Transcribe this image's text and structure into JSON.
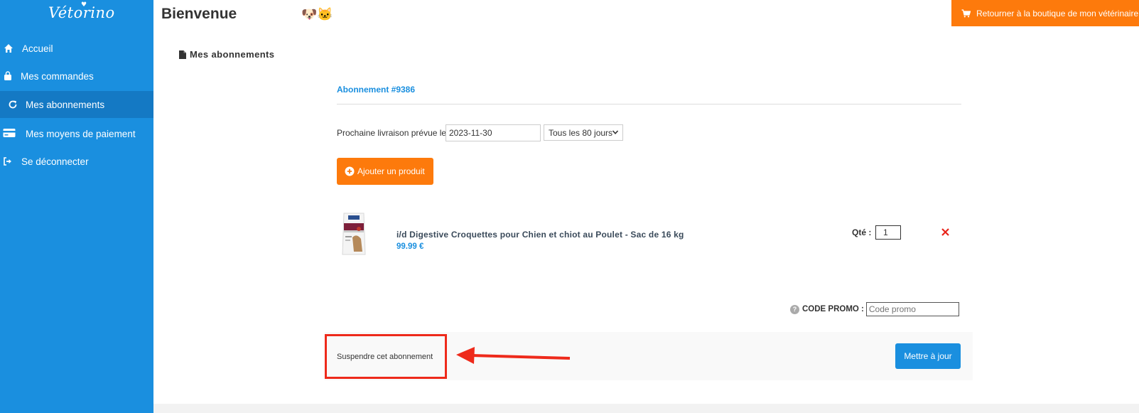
{
  "sidebar": {
    "logo": "Vétorino",
    "items": [
      {
        "label": "Accueil",
        "icon": "home-icon"
      },
      {
        "label": "Mes commandes",
        "icon": "bag-icon"
      },
      {
        "label": "Mes abonnements",
        "icon": "refresh-icon",
        "active": true
      },
      {
        "label": "Mes moyens de paiement",
        "icon": "credit-card-icon"
      },
      {
        "label": "Se déconnecter",
        "icon": "logout-icon"
      }
    ]
  },
  "header": {
    "title": "Bienvenue",
    "pets": "🐶🐱",
    "shop_button": "Retourner à la boutique de mon vétérinaire"
  },
  "section": {
    "title": "Mes abonnements"
  },
  "subscription": {
    "title": "Abonnement #9386",
    "next_delivery_label": "Prochaine livraison prévue le",
    "next_delivery_date": "2023-11-30",
    "frequency": "Tous les 80 jours",
    "add_product_label": "Ajouter un produit",
    "product": {
      "name": "i/d Digestive Croquettes pour Chien et chiot au Poulet - Sac de 16 kg",
      "price": "99.99 €",
      "qty_label": "Qté :",
      "qty": "1"
    },
    "promo_label": "CODE PROMO :",
    "promo_placeholder": "Code promo",
    "suspend_label": "Suspendre cet abonnement",
    "update_label": "Mettre à jour"
  },
  "colors": {
    "sidebar": "#1a8fdf",
    "sidebar_active": "#1479c4",
    "accent_orange": "#fd7a0c",
    "accent_blue": "#1a8fdf",
    "annotation_red": "#ee2a1b"
  }
}
